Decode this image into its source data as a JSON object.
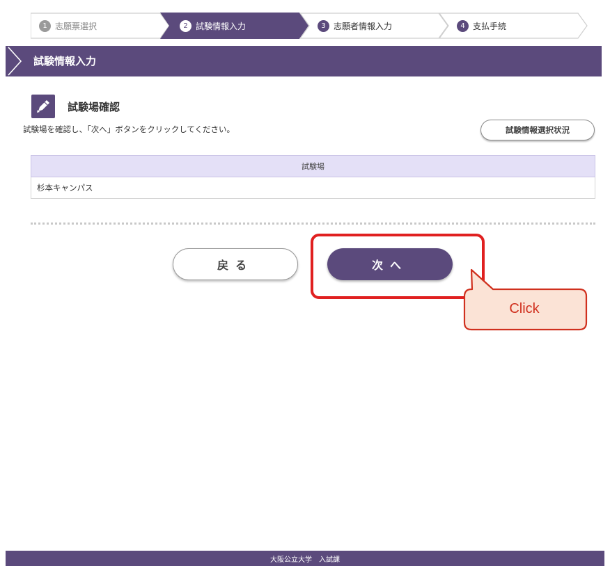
{
  "steps": [
    {
      "num": "1",
      "label": "志願票選択"
    },
    {
      "num": "2",
      "label": "試験情報入力"
    },
    {
      "num": "3",
      "label": "志願者情報入力"
    },
    {
      "num": "4",
      "label": "支払手続"
    }
  ],
  "active_step": 2,
  "header": {
    "title": "試験情報入力"
  },
  "section": {
    "title": "試験場確認",
    "instruction": "試験場を確認し、「次へ」ボタンをクリックしてください。",
    "status_button": "試験情報選択状況"
  },
  "table": {
    "header": "試験場",
    "rows": [
      "杉本キャンパス"
    ]
  },
  "buttons": {
    "back": "戻る",
    "next": "次へ"
  },
  "annotation": {
    "callout": "Click"
  },
  "footer": {
    "text": "大阪公立大学　入試課"
  },
  "colors": {
    "primary": "#5b4a7c",
    "table_header": "#e4e0f7",
    "highlight": "#e02020",
    "callout_fill": "#fbe3d6"
  }
}
